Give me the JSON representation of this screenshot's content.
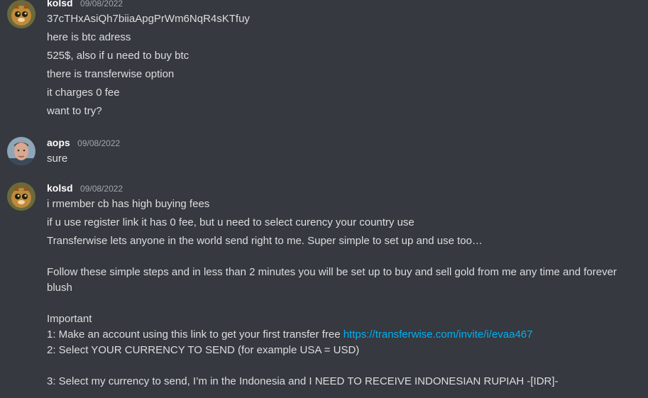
{
  "messages": [
    {
      "username": "kolsd",
      "timestamp": "09/08/2022",
      "lines": [
        "37cTHxAsiQh7biiaApgPrWm6NqR4sKTfuy",
        "here is btc adress",
        "525$, also if u need to buy btc",
        "there is transferwise option",
        "it charges 0 fee",
        "want to try?"
      ]
    },
    {
      "username": "aops",
      "timestamp": "09/08/2022",
      "lines": [
        "sure"
      ]
    },
    {
      "username": "kolsd",
      "timestamp": "09/08/2022",
      "lines": [
        "i rmember cb has high buying fees",
        "if u use register link it has 0 fee, but u need to select curency your country use",
        "Transferwise lets anyone in the world send right to me. Super simple to set up and use too…",
        "Follow these simple steps and in less than 2 minutes you will be set up to buy and sell gold from me any time and forever blush",
        "Important",
        "1: Make an account using this link to get your first transfer free ",
        "https://transferwise.com/invite/i/evaa467",
        "2: Select YOUR CURRENCY TO SEND (for example USA = USD)",
        "3: Select my currency to send, I’m in the Indonesia  and I NEED TO RECEIVE INDONESIAN RUPIAH -[IDR]-"
      ]
    }
  ],
  "colors": {
    "background": "#36393f",
    "username": "#ffffff",
    "timestamp": "#a3a6aa",
    "text": "#dcddde",
    "link": "#00b0f4"
  }
}
